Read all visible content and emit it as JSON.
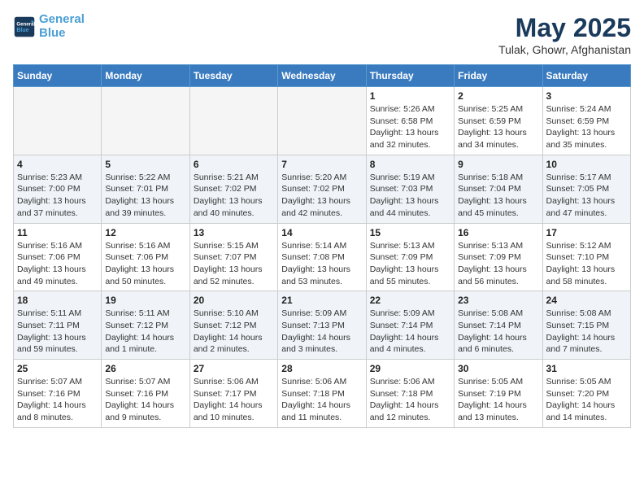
{
  "logo": {
    "line1": "General",
    "line2": "Blue"
  },
  "title": "May 2025",
  "location": "Tulak, Ghowr, Afghanistan",
  "weekdays": [
    "Sunday",
    "Monday",
    "Tuesday",
    "Wednesday",
    "Thursday",
    "Friday",
    "Saturday"
  ],
  "weeks": [
    [
      {
        "day": "",
        "info": ""
      },
      {
        "day": "",
        "info": ""
      },
      {
        "day": "",
        "info": ""
      },
      {
        "day": "",
        "info": ""
      },
      {
        "day": "1",
        "info": "Sunrise: 5:26 AM\nSunset: 6:58 PM\nDaylight: 13 hours\nand 32 minutes."
      },
      {
        "day": "2",
        "info": "Sunrise: 5:25 AM\nSunset: 6:59 PM\nDaylight: 13 hours\nand 34 minutes."
      },
      {
        "day": "3",
        "info": "Sunrise: 5:24 AM\nSunset: 6:59 PM\nDaylight: 13 hours\nand 35 minutes."
      }
    ],
    [
      {
        "day": "4",
        "info": "Sunrise: 5:23 AM\nSunset: 7:00 PM\nDaylight: 13 hours\nand 37 minutes."
      },
      {
        "day": "5",
        "info": "Sunrise: 5:22 AM\nSunset: 7:01 PM\nDaylight: 13 hours\nand 39 minutes."
      },
      {
        "day": "6",
        "info": "Sunrise: 5:21 AM\nSunset: 7:02 PM\nDaylight: 13 hours\nand 40 minutes."
      },
      {
        "day": "7",
        "info": "Sunrise: 5:20 AM\nSunset: 7:02 PM\nDaylight: 13 hours\nand 42 minutes."
      },
      {
        "day": "8",
        "info": "Sunrise: 5:19 AM\nSunset: 7:03 PM\nDaylight: 13 hours\nand 44 minutes."
      },
      {
        "day": "9",
        "info": "Sunrise: 5:18 AM\nSunset: 7:04 PM\nDaylight: 13 hours\nand 45 minutes."
      },
      {
        "day": "10",
        "info": "Sunrise: 5:17 AM\nSunset: 7:05 PM\nDaylight: 13 hours\nand 47 minutes."
      }
    ],
    [
      {
        "day": "11",
        "info": "Sunrise: 5:16 AM\nSunset: 7:06 PM\nDaylight: 13 hours\nand 49 minutes."
      },
      {
        "day": "12",
        "info": "Sunrise: 5:16 AM\nSunset: 7:06 PM\nDaylight: 13 hours\nand 50 minutes."
      },
      {
        "day": "13",
        "info": "Sunrise: 5:15 AM\nSunset: 7:07 PM\nDaylight: 13 hours\nand 52 minutes."
      },
      {
        "day": "14",
        "info": "Sunrise: 5:14 AM\nSunset: 7:08 PM\nDaylight: 13 hours\nand 53 minutes."
      },
      {
        "day": "15",
        "info": "Sunrise: 5:13 AM\nSunset: 7:09 PM\nDaylight: 13 hours\nand 55 minutes."
      },
      {
        "day": "16",
        "info": "Sunrise: 5:13 AM\nSunset: 7:09 PM\nDaylight: 13 hours\nand 56 minutes."
      },
      {
        "day": "17",
        "info": "Sunrise: 5:12 AM\nSunset: 7:10 PM\nDaylight: 13 hours\nand 58 minutes."
      }
    ],
    [
      {
        "day": "18",
        "info": "Sunrise: 5:11 AM\nSunset: 7:11 PM\nDaylight: 13 hours\nand 59 minutes."
      },
      {
        "day": "19",
        "info": "Sunrise: 5:11 AM\nSunset: 7:12 PM\nDaylight: 14 hours\nand 1 minute."
      },
      {
        "day": "20",
        "info": "Sunrise: 5:10 AM\nSunset: 7:12 PM\nDaylight: 14 hours\nand 2 minutes."
      },
      {
        "day": "21",
        "info": "Sunrise: 5:09 AM\nSunset: 7:13 PM\nDaylight: 14 hours\nand 3 minutes."
      },
      {
        "day": "22",
        "info": "Sunrise: 5:09 AM\nSunset: 7:14 PM\nDaylight: 14 hours\nand 4 minutes."
      },
      {
        "day": "23",
        "info": "Sunrise: 5:08 AM\nSunset: 7:14 PM\nDaylight: 14 hours\nand 6 minutes."
      },
      {
        "day": "24",
        "info": "Sunrise: 5:08 AM\nSunset: 7:15 PM\nDaylight: 14 hours\nand 7 minutes."
      }
    ],
    [
      {
        "day": "25",
        "info": "Sunrise: 5:07 AM\nSunset: 7:16 PM\nDaylight: 14 hours\nand 8 minutes."
      },
      {
        "day": "26",
        "info": "Sunrise: 5:07 AM\nSunset: 7:16 PM\nDaylight: 14 hours\nand 9 minutes."
      },
      {
        "day": "27",
        "info": "Sunrise: 5:06 AM\nSunset: 7:17 PM\nDaylight: 14 hours\nand 10 minutes."
      },
      {
        "day": "28",
        "info": "Sunrise: 5:06 AM\nSunset: 7:18 PM\nDaylight: 14 hours\nand 11 minutes."
      },
      {
        "day": "29",
        "info": "Sunrise: 5:06 AM\nSunset: 7:18 PM\nDaylight: 14 hours\nand 12 minutes."
      },
      {
        "day": "30",
        "info": "Sunrise: 5:05 AM\nSunset: 7:19 PM\nDaylight: 14 hours\nand 13 minutes."
      },
      {
        "day": "31",
        "info": "Sunrise: 5:05 AM\nSunset: 7:20 PM\nDaylight: 14 hours\nand 14 minutes."
      }
    ]
  ]
}
